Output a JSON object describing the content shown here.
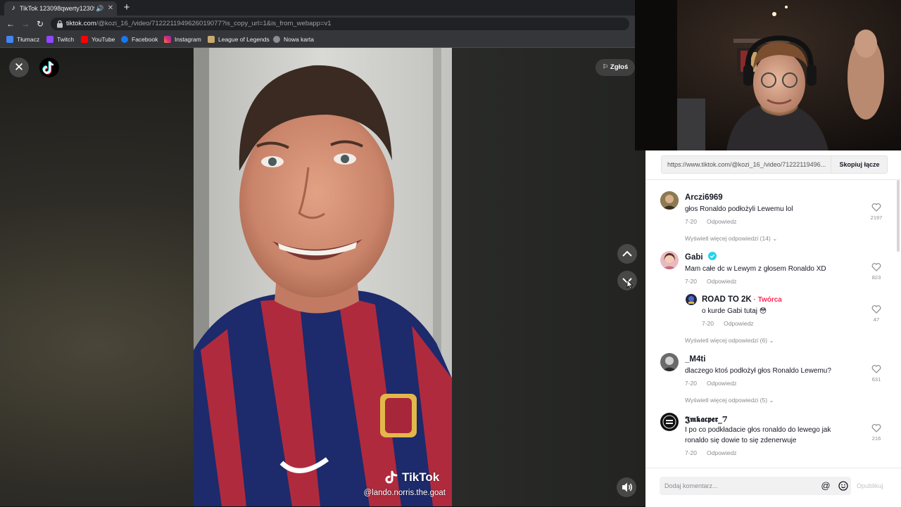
{
  "browser": {
    "tab_title": "TikTok 123098qwerty12309",
    "url_host": "tiktok.com",
    "url_path": "/@kozi_16_/video/7122211949626019077?is_copy_url=1&is_from_webapp=v1",
    "bookmarks": [
      "Tłumacz",
      "Twitch",
      "YouTube",
      "Facebook",
      "Instagram",
      "League of Legends",
      "Nowa karta"
    ]
  },
  "player": {
    "report_label": "Zgłoś",
    "watermark_brand": "TikTok",
    "watermark_user": "@lando.norris.the.goat"
  },
  "panel": {
    "copy_url": "https://www.tiktok.com/@kozi_16_/video/71222119496...",
    "copy_button": "Skopiuj łącze",
    "comments": [
      {
        "user": "Arczi6969",
        "text": "głos Ronaldo podłożyli Lewemu lol",
        "date": "7-20",
        "reply": "Odpowiedz",
        "likes": "2197",
        "more": "Wyświetl więcej odpowiedzi (14)"
      },
      {
        "user": "Gabi",
        "text": "Mam całe dc w Lewym z głosem Ronaldo XD",
        "date": "7-20",
        "reply": "Odpowiedz",
        "likes": "823"
      },
      {
        "user": "ROAD TO 2K",
        "badge": " · Twórca",
        "text": "o kurde Gabi tutaj 😳",
        "date": "7-20",
        "reply": "Odpowiedz",
        "likes": "47",
        "more": "Wyświetl więcej odpowiedzi (6)"
      },
      {
        "user": "_M4ti",
        "text": "dlaczego ktoś podłożył głos Ronaldo Lewemu?",
        "date": "7-20",
        "reply": "Odpowiedz",
        "likes": "631",
        "more": "Wyświetl więcej odpowiedzi (5)"
      },
      {
        "user": "𝕵𝖒𝖐𝖆𝖈𝖕𝖊𝖗_7",
        "text": "I po co podkładacie głos ronaldo do lewego jak ronaldo się dowie to się zdenerwuje",
        "date": "7-20",
        "reply": "Odpowiedz",
        "likes": "216"
      }
    ],
    "input_placeholder": "Dodaj komentarz...",
    "post_label": "Opublikuj"
  },
  "colors": {
    "accent": "#fe2c55",
    "verified": "#20d5ec",
    "chrome_dark": "#202124",
    "chrome_mid": "#35363a"
  }
}
